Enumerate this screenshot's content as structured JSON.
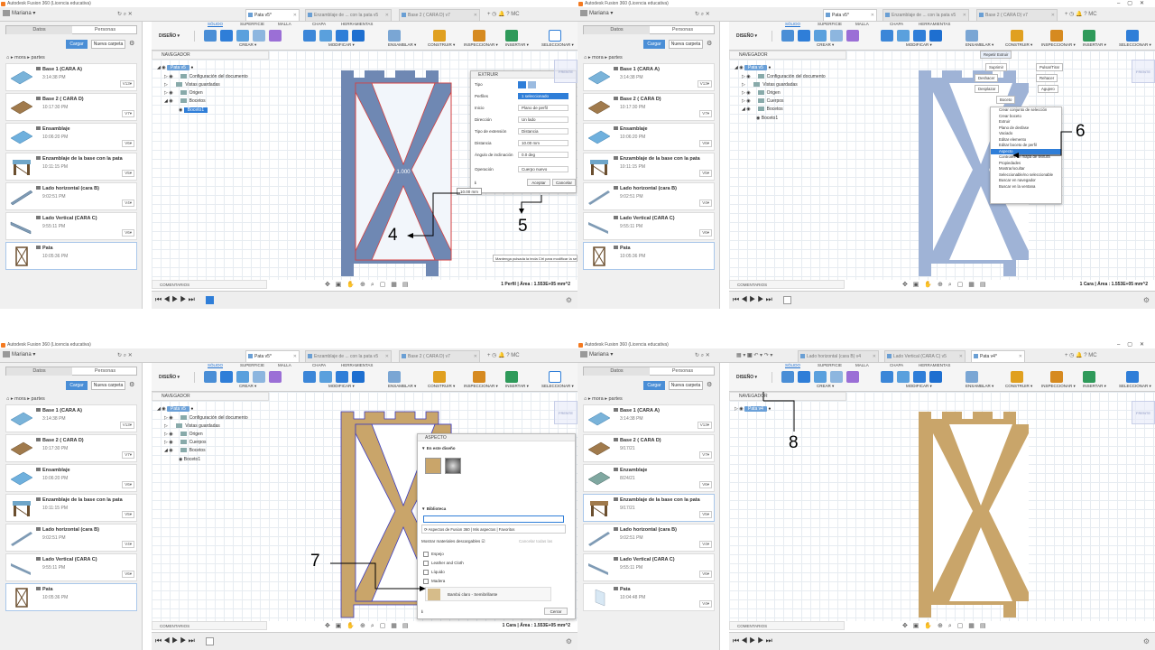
{
  "app": {
    "title": "Autodesk Fusion 360 (Licencia educativa)",
    "user": "Mariana"
  },
  "data_panel": {
    "tabs": [
      "Datos",
      "Personas"
    ],
    "load_button": "Cargar",
    "new_folder_button": "Nueva carpeta",
    "breadcrumb": [
      "mora",
      "partes"
    ]
  },
  "files_a": [
    {
      "name": "Base 1 (CARA A)",
      "date": "3:14:38 PM",
      "version": "V13▾"
    },
    {
      "name": "Base 2 ( CARA D)",
      "date": "10:17:30 PM",
      "version": "V7▾"
    },
    {
      "name": "Ensamblaje",
      "date": "10:06:20 PM",
      "version": "V6▾"
    },
    {
      "name": "Enzamblaje de la base con la pata",
      "date": "10:11:15 PM",
      "version": "V5▾"
    },
    {
      "name": "Lado horizontal (cara B)",
      "date": "9:02:51 PM",
      "version": "V4▾"
    },
    {
      "name": "Lado Vertical (CARA C)",
      "date": "9:55:11 PM",
      "version": "V6▾"
    },
    {
      "name": "Pata",
      "date": "10:05:36 PM",
      "version": ""
    }
  ],
  "files_b": [
    {
      "name": "Base 1 (CARA A)",
      "date": "3:14:38 PM",
      "version": "V13▾"
    },
    {
      "name": "Base 2 ( CARA D)",
      "date": "9/17/21",
      "version": "V7▾"
    },
    {
      "name": "Enzamblaje",
      "date": "8/24/21",
      "version": "V6▾"
    },
    {
      "name": "Enzamblaje de la base con la pata",
      "date": "9/17/21",
      "version": "V5▾"
    },
    {
      "name": "Lado horizontal (cara B)",
      "date": "9:02:51 PM",
      "version": "V4▾"
    },
    {
      "name": "Lado Vertical (CARA C)",
      "date": "9:55:11 PM",
      "version": "V6▾"
    },
    {
      "name": "Pata",
      "date": "10:04:48 PM",
      "version": "V4▾"
    }
  ],
  "doc_tabs_a": [
    {
      "label": "Pata v5*",
      "active": true
    },
    {
      "label": "Enzamblaje de ... con la pata v5",
      "active": false
    },
    {
      "label": "Base 2 ( CARA D) v7",
      "active": false
    }
  ],
  "doc_tabs_b": [
    {
      "label": "Lado horizontal (cara B) v4",
      "active": false
    },
    {
      "label": "Lado Vertical (CARA C) v5",
      "active": false
    },
    {
      "label": "Pata v4*",
      "active": true
    }
  ],
  "toolbar": {
    "workspace": "DISEÑO ▾",
    "tabs": [
      "SÓLIDO",
      "SUPERFICIE",
      "MALLA",
      "CHAPA",
      "HERRAMIENTAS"
    ],
    "groups": [
      "CREAR ▾",
      "MODIFICAR ▾",
      "ENSAMBLAR ▾",
      "CONSTRUIR ▾",
      "INSPECCIONAR ▾",
      "INSERTAR ▾",
      "SELECCIONAR ▾"
    ]
  },
  "browser": {
    "title": "NAVEGADOR",
    "root_v5": "Pata v5",
    "root_v4": "Pata v4",
    "items": [
      "Configuración del documento",
      "Vistas guardadas",
      "Origen",
      "Cuerpos",
      "Bocetos",
      "Boceto1"
    ]
  },
  "comments_label": "COMENTARIOS",
  "viewcube_label": "FRENTE",
  "status": {
    "q1": "1 Perfil | Área : 1.553E+05 mm^2",
    "q2": "1 Cara | Área : 1.553E+05 mm^2",
    "q3": "1 Cara | Área : 1.553E+05 mm^2"
  },
  "extrude_dialog": {
    "title": "EXTRUIR",
    "rows": [
      {
        "label": "Tipo",
        "value": ""
      },
      {
        "label": "Perfiles",
        "value": "1 seleccionado"
      },
      {
        "label": "Inicio",
        "value": "Plano de perfil"
      },
      {
        "label": "Dirección",
        "value": "Un lado"
      },
      {
        "label": "Tipo de extensión",
        "value": "Distancia"
      },
      {
        "label": "Distancia",
        "value": "10.00 mm"
      },
      {
        "label": "Ángulo de inclinación",
        "value": "0.0 deg"
      },
      {
        "label": "Operación",
        "value": "Cuerpo nuevo"
      }
    ],
    "ok": "Aceptar",
    "cancel": "Cancelar",
    "distance_tag": "10.00 mm",
    "hint": "Mantenga pulsada la tecla Ctrl para modificar la se"
  },
  "context_menu": {
    "top_buttons": [
      "Suprimir",
      "Deshacer",
      "Desplazar",
      "Boceto",
      "Pulsar/Tirar",
      "Rehacer",
      "Agujero"
    ],
    "repeat": "Repetir Extruir",
    "items": [
      "Crear conjunto de selección",
      "Crear boceto",
      "Extruir",
      "Plano de desfase",
      "Vaciado",
      "Editar elemento",
      "Editar boceto de perfil",
      "Aspecto",
      "Controles de mapa de textura",
      "Propiedades",
      "Mostrar/ocultar",
      "Seleccionable/no seleccionable",
      "Buscar en navegador",
      "Buscar en la ventana"
    ]
  },
  "appearance_dialog": {
    "title": "ASPECTO",
    "in_design": "En este diseño",
    "library": "Biblioteca",
    "tabs": [
      "Aspectos de Fusion 360",
      "Mis aspectos",
      "Favoritos"
    ],
    "show_downloadable": "Mostrar materiales descargables",
    "cancel_all": "Cancelar todas las",
    "categories": [
      "Espejo",
      "Leather and Cloth",
      "Líquido",
      "Madera"
    ],
    "item": "Bambú claro - Semibrillante",
    "close": "Cerrar"
  },
  "annotations": [
    "4",
    "5",
    "6",
    "7",
    "8"
  ],
  "colors": {
    "accent": "#2f7ed8",
    "body_blue": "#6f88b3",
    "wood": "#c9a56a",
    "sketch_red": "#d64040"
  }
}
